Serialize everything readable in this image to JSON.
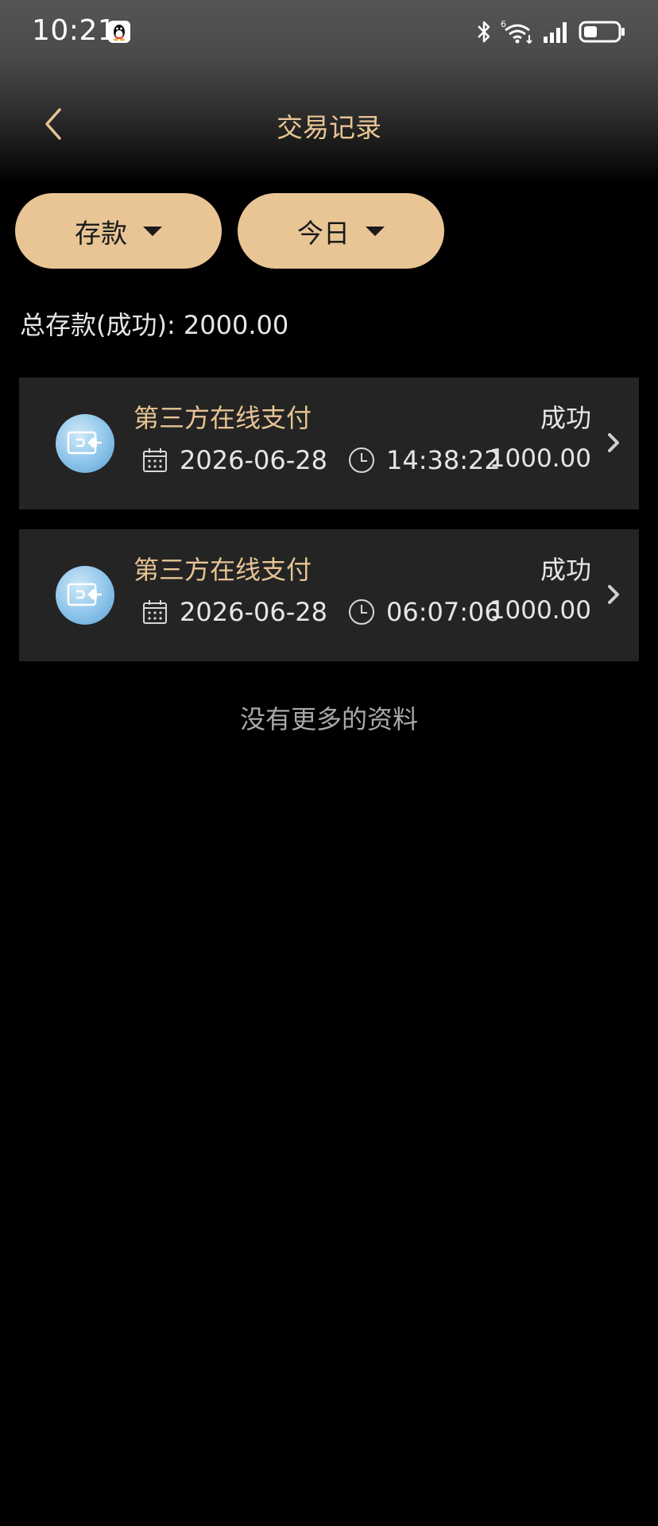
{
  "status_bar": {
    "time": "10:21",
    "icons": [
      "qq-icon",
      "bluetooth-icon",
      "wifi-icon",
      "signal-icon",
      "battery-icon"
    ]
  },
  "nav": {
    "title": "交易记录",
    "back_icon": "chevron-left-icon"
  },
  "filters": {
    "type_label": "存款",
    "period_label": "今日"
  },
  "summary": {
    "total_label": "总存款(成功): 2000.00"
  },
  "records": [
    {
      "title": "第三方在线支付",
      "status": "成功",
      "date": "2026-06-28",
      "time": "14:38:22",
      "amount": "1000.00"
    },
    {
      "title": "第三方在线支付",
      "status": "成功",
      "date": "2026-06-28",
      "time": "06:07:06",
      "amount": "1000.00"
    }
  ],
  "footer": {
    "no_more": "没有更多的资料"
  },
  "colors": {
    "accent": "#e8c494",
    "button_bg": "#e9c595",
    "card_bg": "#242424",
    "background": "#000000"
  }
}
